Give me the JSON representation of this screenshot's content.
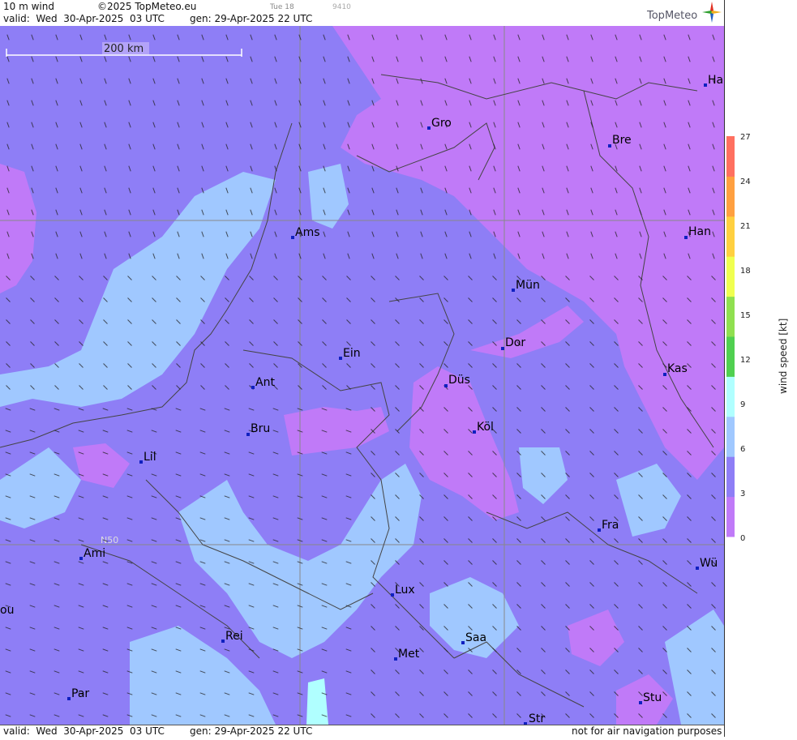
{
  "header": {
    "product": "10 m wind",
    "copyright": "©2025 TopMeteo.eu",
    "day_hour": "Tue 18",
    "code": "9410",
    "valid": "valid:  Wed  30-Apr-2025  03 UTC",
    "generated": "gen: 29-Apr-2025 22 UTC",
    "logo_text": "TopMeteo"
  },
  "footer": {
    "valid": "valid:  Wed  30-Apr-2025  03 UTC",
    "generated": "gen: 29-Apr-2025 22 UTC",
    "disclaimer": "not for air navigation purposes"
  },
  "map": {
    "scale_label": "200 km",
    "lat_label": "N50",
    "cities": [
      {
        "name": "Ha"
      },
      {
        "name": "Gro"
      },
      {
        "name": "Bre"
      },
      {
        "name": "Ams"
      },
      {
        "name": "Han"
      },
      {
        "name": "Mün"
      },
      {
        "name": "Ein"
      },
      {
        "name": "Dor"
      },
      {
        "name": "Kas"
      },
      {
        "name": "Ant"
      },
      {
        "name": "Düs"
      },
      {
        "name": "Bru"
      },
      {
        "name": "Köl"
      },
      {
        "name": "Lil"
      },
      {
        "name": "Fra"
      },
      {
        "name": "Ami"
      },
      {
        "name": "Wü"
      },
      {
        "name": "Lux"
      },
      {
        "name": "ou"
      },
      {
        "name": "Rei"
      },
      {
        "name": "Saa"
      },
      {
        "name": "Met"
      },
      {
        "name": "Par"
      },
      {
        "name": "Stu"
      },
      {
        "name": "Str"
      }
    ]
  },
  "legend": {
    "title": "wind  speed  [kt]",
    "ticks": [
      "27",
      "24",
      "21",
      "18",
      "15",
      "12",
      "9",
      "6",
      "3",
      "0"
    ],
    "colors": [
      "#ff7060",
      "#ffa040",
      "#ffd040",
      "#f0ff50",
      "#90e050",
      "#50d050",
      "#b0ffff",
      "#a0c8ff",
      "#8e7ef6",
      "#c07af8"
    ]
  }
}
